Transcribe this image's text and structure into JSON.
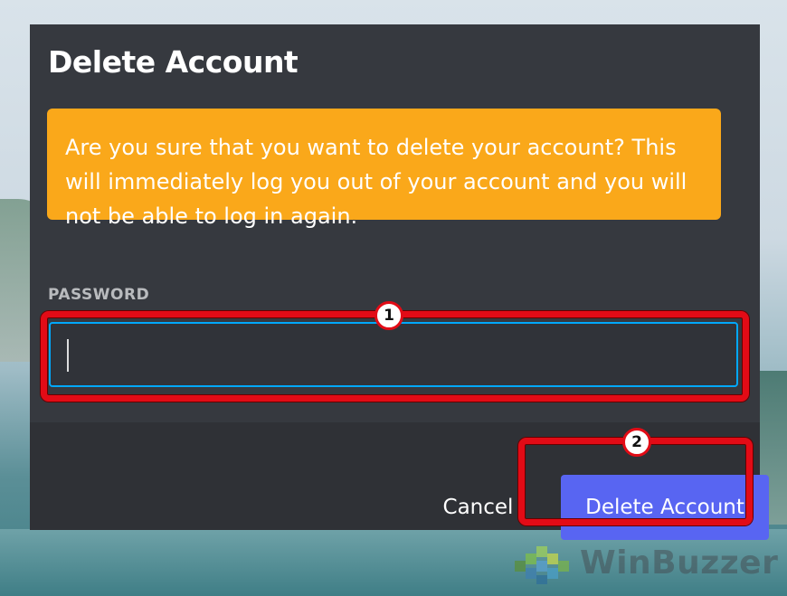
{
  "dialog": {
    "title": "Delete Account",
    "warning": "Are you sure that you want to delete your account? This will immediately log you out of your account and you will not be able to log in again.",
    "password_label": "PASSWORD",
    "password_value": "",
    "cancel_label": "Cancel",
    "delete_label": "Delete Account"
  },
  "annotations": {
    "step1": "1",
    "step2": "2"
  },
  "watermark": {
    "text": "WinBuzzer"
  },
  "colors": {
    "dialog_bg": "#36393f",
    "footer_bg": "#2f3136",
    "warning_bg": "#faa81a",
    "primary_button": "#5865f2",
    "input_focus_border": "#00a8fc",
    "callout_red": "#e20b16"
  }
}
